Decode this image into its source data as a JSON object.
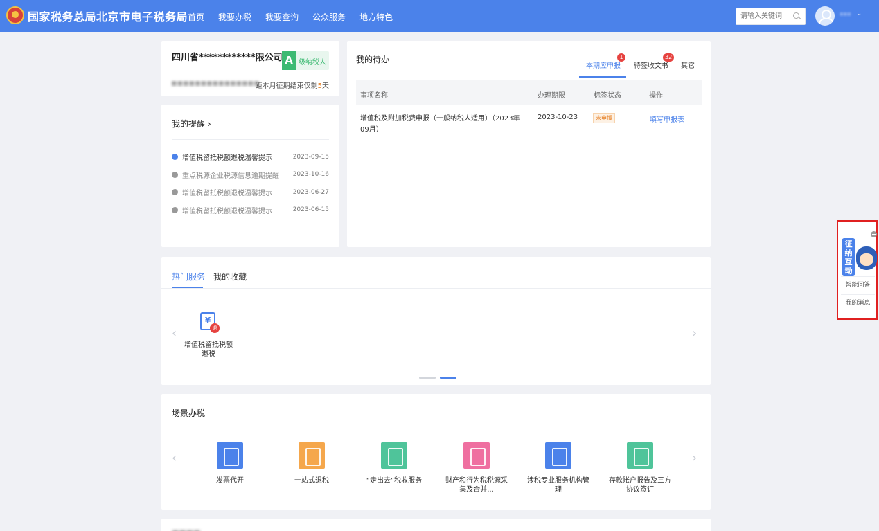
{
  "header": {
    "site_title": "国家税务总局北京市电子税务局",
    "nav": [
      "首页",
      "我要办税",
      "我要查询",
      "公众服务",
      "地方特色"
    ],
    "search_placeholder": "请输入关键词",
    "accent_color": "#4b82ea"
  },
  "company": {
    "name": "四川省************限公司",
    "grade_letter": "A",
    "grade_label": "级纳税人",
    "deadline_prefix": "距本月征期结束仅剩",
    "deadline_days": "5",
    "deadline_suffix": "天"
  },
  "reminders": {
    "title": "我的提醒 ›",
    "items": [
      {
        "text": "增值税留抵税额退税温馨提示",
        "date": "2023-09-15",
        "icon": "info-icon"
      },
      {
        "text": "重点税源企业税源信息逾期提醒",
        "date": "2023-10-16",
        "icon": "info-icon"
      },
      {
        "text": "增值税留抵税额退税温馨提示",
        "date": "2023-06-27",
        "icon": "info-icon"
      },
      {
        "text": "增值税留抵税额退税温馨提示",
        "date": "2023-06-15",
        "icon": "info-icon"
      }
    ]
  },
  "todo": {
    "title": "我的待办",
    "tabs": [
      {
        "label": "本期应申报",
        "badge": "1"
      },
      {
        "label": "待签收文书",
        "badge": "32"
      },
      {
        "label": "其它",
        "badge": ""
      }
    ],
    "columns": [
      "事项名称",
      "办理期限",
      "标签状态",
      "操作"
    ],
    "rows": [
      {
        "name": "增值税及附加税费申报（一般纳税人适用）（2023年09月）",
        "deadline": "2023-10-23",
        "status": "未申报",
        "action": "填写申报表"
      }
    ]
  },
  "hot": {
    "tabs": [
      "热门服务",
      "我的收藏"
    ],
    "services": [
      {
        "label": "增值税留抵税额退税",
        "icon": "refund-document-icon",
        "glyph": "¥",
        "badge": "退"
      }
    ],
    "prev_arrow": "‹",
    "next_arrow": "›"
  },
  "scene": {
    "title": "场景办税",
    "prev_arrow": "‹",
    "next_arrow": "›",
    "items": [
      {
        "label": "发票代开",
        "color": "#4b82ea",
        "icon": "invoice-icon"
      },
      {
        "label": "一站式退税",
        "color": "#f5a74c",
        "icon": "refund-icon"
      },
      {
        "label": "“走出去”税收服务",
        "color": "#4fc49a",
        "icon": "tax-globe-icon"
      },
      {
        "label": "财产和行为税税源采集及合并...",
        "color": "#ef6fa0",
        "icon": "property-tax-icon"
      },
      {
        "label": "涉税专业服务机构管理",
        "color": "#4b82ea",
        "icon": "building-icon"
      },
      {
        "label": "存款账户报告及三方协议签订",
        "color": "#4fc49a",
        "icon": "account-icon"
      }
    ]
  },
  "assistant": {
    "bubble_text": "征纳互动",
    "btn_qa": "智能问答",
    "btn_msg": "我的消息"
  }
}
